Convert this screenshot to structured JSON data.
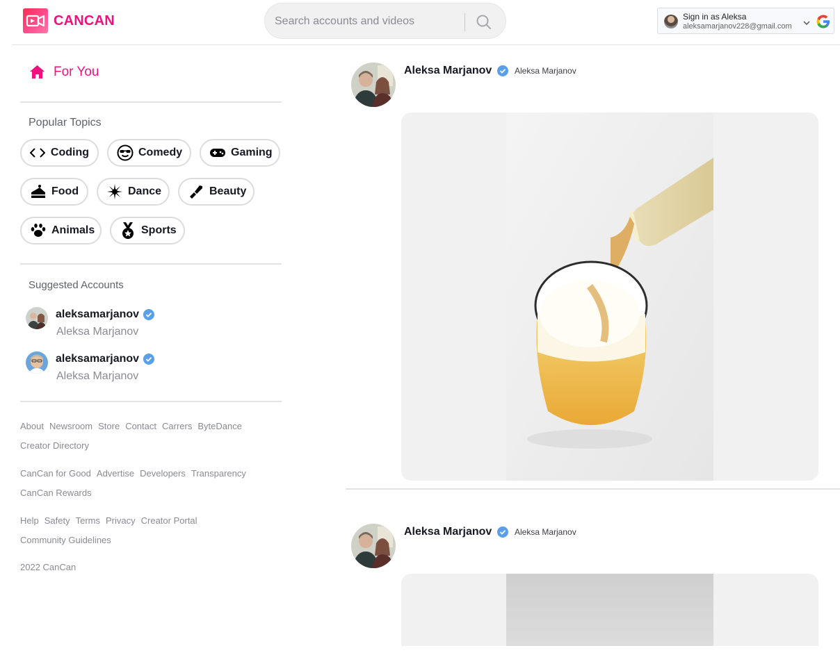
{
  "brand": {
    "name": "CANCAN",
    "accent": "#f0117f"
  },
  "search": {
    "placeholder": "Search accounts and videos",
    "value": ""
  },
  "signin": {
    "title": "Sign in as Aleksa",
    "email": "aleksamarjanov228@gmail.com"
  },
  "sidebar": {
    "for_you": "For You",
    "popular_topics_title": "Popular Topics",
    "topics": [
      {
        "label": "Coding",
        "icon": "code-icon"
      },
      {
        "label": "Comedy",
        "icon": "sunglasses-face-icon"
      },
      {
        "label": "Gaming",
        "icon": "gamepad-icon"
      },
      {
        "label": "Food",
        "icon": "cake-icon"
      },
      {
        "label": "Dance",
        "icon": "disco-ball-icon"
      },
      {
        "label": "Beauty",
        "icon": "lipstick-icon"
      },
      {
        "label": "Animals",
        "icon": "paw-icon"
      },
      {
        "label": "Sports",
        "icon": "medal-icon"
      }
    ],
    "suggested_title": "Suggested Accounts",
    "suggested": [
      {
        "username": "aleksamarjanov",
        "name": "Aleksa Marjanov"
      },
      {
        "username": "aleksamarjanov",
        "name": "Aleksa Marjanov"
      }
    ],
    "footer_rows": [
      [
        "About",
        "Newsroom",
        "Store",
        "Contact",
        "Carrers",
        "ByteDance"
      ],
      [
        "Creator Directory"
      ],
      [
        "CanCan for Good",
        "Advertise",
        "Developers",
        "Transparency"
      ],
      [
        "CanCan Rewards"
      ],
      [
        "Help",
        "Safety",
        "Terms",
        "Privacy",
        "Creator Portal"
      ],
      [
        "Community Guidelines"
      ]
    ],
    "copyright": "2022 CanCan"
  },
  "feed": [
    {
      "name": "Aleksa Marjanov",
      "nickname": "Aleksa Marjanov"
    },
    {
      "name": "Aleksa Marjanov",
      "nickname": "Aleksa Marjanov"
    }
  ]
}
